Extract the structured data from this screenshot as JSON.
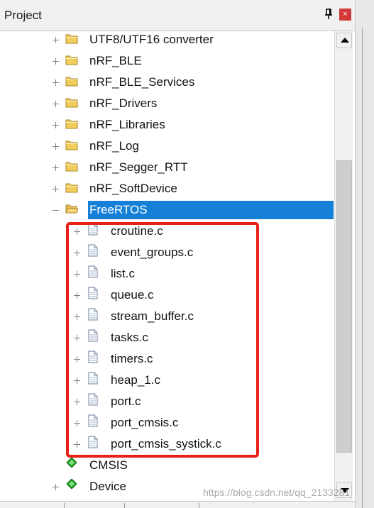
{
  "panel": {
    "title": "Project",
    "pin_glyph": "█",
    "close_glyph": "×",
    "accent_color": "#1680d8",
    "highlight_color": "#e8201a"
  },
  "tree": {
    "items": [
      {
        "label": "UTF8/UTF16 converter",
        "icon": "folder-icon",
        "expander": "plus"
      },
      {
        "label": "nRF_BLE",
        "icon": "folder-icon",
        "expander": "plus"
      },
      {
        "label": "nRF_BLE_Services",
        "icon": "folder-icon",
        "expander": "plus"
      },
      {
        "label": "nRF_Drivers",
        "icon": "folder-icon",
        "expander": "plus"
      },
      {
        "label": "nRF_Libraries",
        "icon": "folder-icon",
        "expander": "plus"
      },
      {
        "label": "nRF_Log",
        "icon": "folder-icon",
        "expander": "plus"
      },
      {
        "label": "nRF_Segger_RTT",
        "icon": "folder-icon",
        "expander": "plus"
      },
      {
        "label": "nRF_SoftDevice",
        "icon": "folder-icon",
        "expander": "plus"
      },
      {
        "label": "FreeRTOS",
        "icon": "open-folder-icon",
        "expander": "minus",
        "selected": true
      },
      {
        "label": "croutine.c",
        "icon": "file-icon",
        "expander": "plus"
      },
      {
        "label": "event_groups.c",
        "icon": "file-icon",
        "expander": "plus"
      },
      {
        "label": "list.c",
        "icon": "file-icon",
        "expander": "plus"
      },
      {
        "label": "queue.c",
        "icon": "file-icon",
        "expander": "plus"
      },
      {
        "label": "stream_buffer.c",
        "icon": "file-icon",
        "expander": "plus"
      },
      {
        "label": "tasks.c",
        "icon": "file-icon",
        "expander": "plus"
      },
      {
        "label": "timers.c",
        "icon": "file-icon",
        "expander": "plus"
      },
      {
        "label": "heap_1.c",
        "icon": "file-icon",
        "expander": "plus"
      },
      {
        "label": "port.c",
        "icon": "file-icon",
        "expander": "plus"
      },
      {
        "label": "port_cmsis.c",
        "icon": "file-icon",
        "expander": "plus"
      },
      {
        "label": "port_cmsis_systick.c",
        "icon": "file-icon",
        "expander": "plus"
      },
      {
        "label": "CMSIS",
        "icon": "green-gem-icon",
        "expander": "none"
      },
      {
        "label": "Device",
        "icon": "green-gem-icon",
        "expander": "plus"
      }
    ]
  },
  "watermark": "https://blog.csdn.net/qq_2133281"
}
